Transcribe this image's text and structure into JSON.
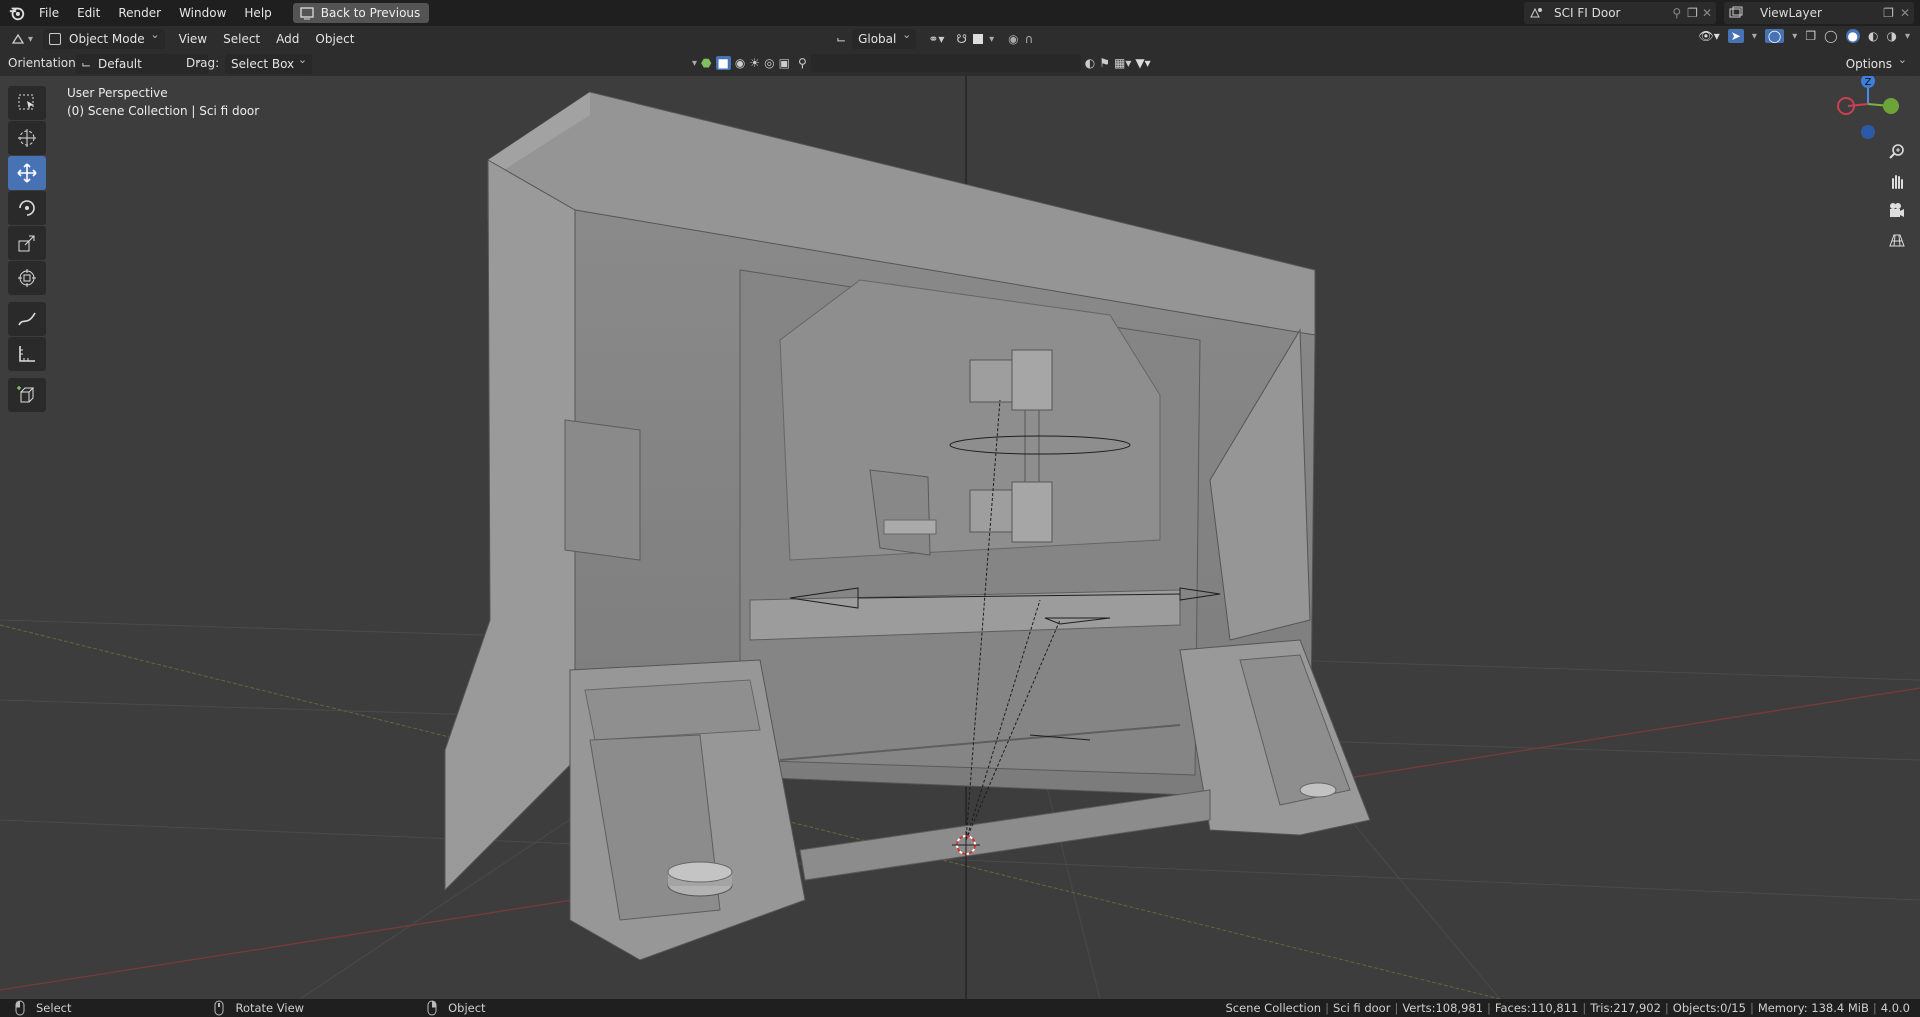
{
  "topbar": {
    "menu": [
      "File",
      "Edit",
      "Render",
      "Window",
      "Help"
    ],
    "back_label": "Back to Previous",
    "scene_name": "SCI FI Door",
    "view_layer": "ViewLayer"
  },
  "header": {
    "mode": "Object Mode",
    "menus": [
      "View",
      "Select",
      "Add",
      "Object"
    ],
    "transform_orientation": "Global"
  },
  "tool_header": {
    "orientation_label": "Orientation:",
    "orientation_value": "Default",
    "drag_label": "Drag:",
    "drag_value": "Select Box",
    "options_label": "Options"
  },
  "viewport": {
    "perspective": "User Perspective",
    "collection_path": "(0) Scene Collection | Sci fi door",
    "gizmo_axes": [
      "Z"
    ],
    "accent_color": "#4772b3"
  },
  "toolbar": {
    "tools": [
      "select-box-icon",
      "cursor-icon",
      "move-icon",
      "rotate-icon",
      "scale-icon",
      "transform-icon",
      "annotate-icon",
      "measure-icon",
      "add-cube-icon"
    ],
    "active_tool": "move-icon"
  },
  "statusbar": {
    "left": [
      {
        "label": "Select"
      },
      {
        "label": "Rotate View"
      },
      {
        "label": "Object"
      }
    ],
    "scene": "Scene Collection",
    "object": "Sci fi door",
    "verts": "Verts:108,981",
    "faces": "Faces:110,811",
    "tris": "Tris:217,902",
    "objects": "Objects:0/15",
    "memory": "Memory: 138.4 MiB",
    "version": "4.0.0"
  }
}
